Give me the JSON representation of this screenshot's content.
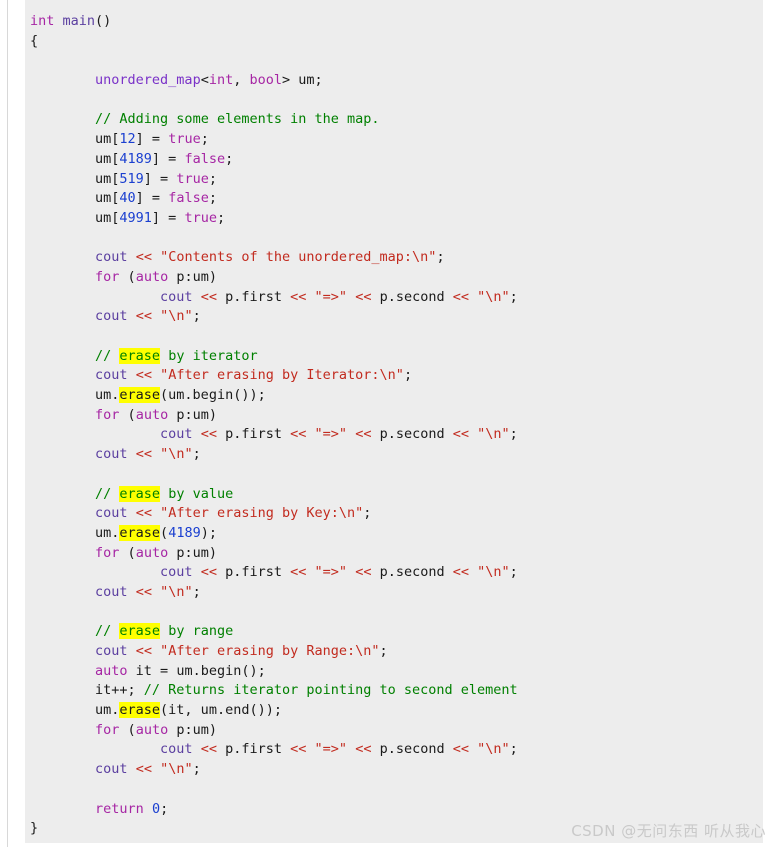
{
  "watermark": {
    "text": "CSDN @无问东西 听从我心"
  },
  "colors": {
    "page_background": "#ffffff",
    "code_background": "#ededed",
    "keyword": "#a626a4",
    "type": "#7a32c8",
    "identifier": "#5b3fa0",
    "number": "#1a3fd0",
    "string": "#c22b1f",
    "comment": "#008000",
    "plain": "#1a1a1a",
    "highlight": "#ffff00",
    "rule": "#d8d8d8",
    "watermark": "#c9c9c9"
  },
  "code": {
    "language": "cpp",
    "highlight_term": "erase",
    "lines": [
      {
        "n": 1,
        "tokens": [
          {
            "t": "int",
            "c": "kw"
          },
          {
            "t": " ",
            "c": "plain"
          },
          {
            "t": "main",
            "c": "ident"
          },
          {
            "t": "()",
            "c": "plain"
          }
        ]
      },
      {
        "n": 2,
        "tokens": [
          {
            "t": "{",
            "c": "plain"
          }
        ]
      },
      {
        "n": 3,
        "tokens": []
      },
      {
        "n": 4,
        "tokens": [
          {
            "t": "        ",
            "c": "plain"
          },
          {
            "t": "unordered_map",
            "c": "type"
          },
          {
            "t": "<",
            "c": "plain"
          },
          {
            "t": "int",
            "c": "kw"
          },
          {
            "t": ", ",
            "c": "plain"
          },
          {
            "t": "bool",
            "c": "kw"
          },
          {
            "t": "> um;",
            "c": "plain"
          }
        ]
      },
      {
        "n": 5,
        "tokens": []
      },
      {
        "n": 6,
        "tokens": [
          {
            "t": "        ",
            "c": "plain"
          },
          {
            "t": "// Adding some elements in the map.",
            "c": "cmt"
          }
        ]
      },
      {
        "n": 7,
        "tokens": [
          {
            "t": "        um[",
            "c": "plain"
          },
          {
            "t": "12",
            "c": "num"
          },
          {
            "t": "] = ",
            "c": "plain"
          },
          {
            "t": "true",
            "c": "kw"
          },
          {
            "t": ";",
            "c": "plain"
          }
        ]
      },
      {
        "n": 8,
        "tokens": [
          {
            "t": "        um[",
            "c": "plain"
          },
          {
            "t": "4189",
            "c": "num"
          },
          {
            "t": "] = ",
            "c": "plain"
          },
          {
            "t": "false",
            "c": "kw"
          },
          {
            "t": ";",
            "c": "plain"
          }
        ]
      },
      {
        "n": 9,
        "tokens": [
          {
            "t": "        um[",
            "c": "plain"
          },
          {
            "t": "519",
            "c": "num"
          },
          {
            "t": "] = ",
            "c": "plain"
          },
          {
            "t": "true",
            "c": "kw"
          },
          {
            "t": ";",
            "c": "plain"
          }
        ]
      },
      {
        "n": 10,
        "tokens": [
          {
            "t": "        um[",
            "c": "plain"
          },
          {
            "t": "40",
            "c": "num"
          },
          {
            "t": "] = ",
            "c": "plain"
          },
          {
            "t": "false",
            "c": "kw"
          },
          {
            "t": ";",
            "c": "plain"
          }
        ]
      },
      {
        "n": 11,
        "tokens": [
          {
            "t": "        um[",
            "c": "plain"
          },
          {
            "t": "4991",
            "c": "num"
          },
          {
            "t": "] = ",
            "c": "plain"
          },
          {
            "t": "true",
            "c": "kw"
          },
          {
            "t": ";",
            "c": "plain"
          }
        ]
      },
      {
        "n": 12,
        "tokens": []
      },
      {
        "n": 13,
        "tokens": [
          {
            "t": "        ",
            "c": "plain"
          },
          {
            "t": "cout",
            "c": "ident"
          },
          {
            "t": " ",
            "c": "plain"
          },
          {
            "t": "<<",
            "c": "op"
          },
          {
            "t": " ",
            "c": "plain"
          },
          {
            "t": "\"Contents of the unordered_map:\\n\"",
            "c": "str"
          },
          {
            "t": ";",
            "c": "plain"
          }
        ]
      },
      {
        "n": 14,
        "tokens": [
          {
            "t": "        ",
            "c": "plain"
          },
          {
            "t": "for",
            "c": "kw"
          },
          {
            "t": " (",
            "c": "plain"
          },
          {
            "t": "auto",
            "c": "kw"
          },
          {
            "t": " p:um)",
            "c": "plain"
          }
        ]
      },
      {
        "n": 15,
        "tokens": [
          {
            "t": "                ",
            "c": "plain"
          },
          {
            "t": "cout",
            "c": "ident"
          },
          {
            "t": " ",
            "c": "plain"
          },
          {
            "t": "<<",
            "c": "op"
          },
          {
            "t": " p.first ",
            "c": "plain"
          },
          {
            "t": "<<",
            "c": "op"
          },
          {
            "t": " ",
            "c": "plain"
          },
          {
            "t": "\"=>\"",
            "c": "str"
          },
          {
            "t": " ",
            "c": "plain"
          },
          {
            "t": "<<",
            "c": "op"
          },
          {
            "t": " p.second ",
            "c": "plain"
          },
          {
            "t": "<<",
            "c": "op"
          },
          {
            "t": " ",
            "c": "plain"
          },
          {
            "t": "\"\\n\"",
            "c": "str"
          },
          {
            "t": ";",
            "c": "plain"
          }
        ]
      },
      {
        "n": 16,
        "tokens": [
          {
            "t": "        ",
            "c": "plain"
          },
          {
            "t": "cout",
            "c": "ident"
          },
          {
            "t": " ",
            "c": "plain"
          },
          {
            "t": "<<",
            "c": "op"
          },
          {
            "t": " ",
            "c": "plain"
          },
          {
            "t": "\"\\n\"",
            "c": "str"
          },
          {
            "t": ";",
            "c": "plain"
          }
        ]
      },
      {
        "n": 17,
        "tokens": []
      },
      {
        "n": 18,
        "tokens": [
          {
            "t": "        ",
            "c": "plain"
          },
          {
            "t": "// ",
            "c": "cmt"
          },
          {
            "t": "erase",
            "c": "hl-cmt"
          },
          {
            "t": " by iterator",
            "c": "cmt"
          }
        ]
      },
      {
        "n": 19,
        "tokens": [
          {
            "t": "        ",
            "c": "plain"
          },
          {
            "t": "cout",
            "c": "ident"
          },
          {
            "t": " ",
            "c": "plain"
          },
          {
            "t": "<<",
            "c": "op"
          },
          {
            "t": " ",
            "c": "plain"
          },
          {
            "t": "\"After erasing by Iterator:\\n\"",
            "c": "str"
          },
          {
            "t": ";",
            "c": "plain"
          }
        ]
      },
      {
        "n": 20,
        "tokens": [
          {
            "t": "        um.",
            "c": "plain"
          },
          {
            "t": "erase",
            "c": "hl-code"
          },
          {
            "t": "(um.begin());",
            "c": "plain"
          }
        ]
      },
      {
        "n": 21,
        "tokens": [
          {
            "t": "        ",
            "c": "plain"
          },
          {
            "t": "for",
            "c": "kw"
          },
          {
            "t": " (",
            "c": "plain"
          },
          {
            "t": "auto",
            "c": "kw"
          },
          {
            "t": " p:um)",
            "c": "plain"
          }
        ]
      },
      {
        "n": 22,
        "tokens": [
          {
            "t": "                ",
            "c": "plain"
          },
          {
            "t": "cout",
            "c": "ident"
          },
          {
            "t": " ",
            "c": "plain"
          },
          {
            "t": "<<",
            "c": "op"
          },
          {
            "t": " p.first ",
            "c": "plain"
          },
          {
            "t": "<<",
            "c": "op"
          },
          {
            "t": " ",
            "c": "plain"
          },
          {
            "t": "\"=>\"",
            "c": "str"
          },
          {
            "t": " ",
            "c": "plain"
          },
          {
            "t": "<<",
            "c": "op"
          },
          {
            "t": " p.second ",
            "c": "plain"
          },
          {
            "t": "<<",
            "c": "op"
          },
          {
            "t": " ",
            "c": "plain"
          },
          {
            "t": "\"\\n\"",
            "c": "str"
          },
          {
            "t": ";",
            "c": "plain"
          }
        ]
      },
      {
        "n": 23,
        "tokens": [
          {
            "t": "        ",
            "c": "plain"
          },
          {
            "t": "cout",
            "c": "ident"
          },
          {
            "t": " ",
            "c": "plain"
          },
          {
            "t": "<<",
            "c": "op"
          },
          {
            "t": " ",
            "c": "plain"
          },
          {
            "t": "\"\\n\"",
            "c": "str"
          },
          {
            "t": ";",
            "c": "plain"
          }
        ]
      },
      {
        "n": 24,
        "tokens": []
      },
      {
        "n": 25,
        "tokens": [
          {
            "t": "        ",
            "c": "plain"
          },
          {
            "t": "// ",
            "c": "cmt"
          },
          {
            "t": "erase",
            "c": "hl-cmt"
          },
          {
            "t": " by value",
            "c": "cmt"
          }
        ]
      },
      {
        "n": 26,
        "tokens": [
          {
            "t": "        ",
            "c": "plain"
          },
          {
            "t": "cout",
            "c": "ident"
          },
          {
            "t": " ",
            "c": "plain"
          },
          {
            "t": "<<",
            "c": "op"
          },
          {
            "t": " ",
            "c": "plain"
          },
          {
            "t": "\"After erasing by Key:\\n\"",
            "c": "str"
          },
          {
            "t": ";",
            "c": "plain"
          }
        ]
      },
      {
        "n": 27,
        "tokens": [
          {
            "t": "        um.",
            "c": "plain"
          },
          {
            "t": "erase",
            "c": "hl-code"
          },
          {
            "t": "(",
            "c": "plain"
          },
          {
            "t": "4189",
            "c": "num"
          },
          {
            "t": ");",
            "c": "plain"
          }
        ]
      },
      {
        "n": 28,
        "tokens": [
          {
            "t": "        ",
            "c": "plain"
          },
          {
            "t": "for",
            "c": "kw"
          },
          {
            "t": " (",
            "c": "plain"
          },
          {
            "t": "auto",
            "c": "kw"
          },
          {
            "t": " p:um)",
            "c": "plain"
          }
        ]
      },
      {
        "n": 29,
        "tokens": [
          {
            "t": "                ",
            "c": "plain"
          },
          {
            "t": "cout",
            "c": "ident"
          },
          {
            "t": " ",
            "c": "plain"
          },
          {
            "t": "<<",
            "c": "op"
          },
          {
            "t": " p.first ",
            "c": "plain"
          },
          {
            "t": "<<",
            "c": "op"
          },
          {
            "t": " ",
            "c": "plain"
          },
          {
            "t": "\"=>\"",
            "c": "str"
          },
          {
            "t": " ",
            "c": "plain"
          },
          {
            "t": "<<",
            "c": "op"
          },
          {
            "t": " p.second ",
            "c": "plain"
          },
          {
            "t": "<<",
            "c": "op"
          },
          {
            "t": " ",
            "c": "plain"
          },
          {
            "t": "\"\\n\"",
            "c": "str"
          },
          {
            "t": ";",
            "c": "plain"
          }
        ]
      },
      {
        "n": 30,
        "tokens": [
          {
            "t": "        ",
            "c": "plain"
          },
          {
            "t": "cout",
            "c": "ident"
          },
          {
            "t": " ",
            "c": "plain"
          },
          {
            "t": "<<",
            "c": "op"
          },
          {
            "t": " ",
            "c": "plain"
          },
          {
            "t": "\"\\n\"",
            "c": "str"
          },
          {
            "t": ";",
            "c": "plain"
          }
        ]
      },
      {
        "n": 31,
        "tokens": []
      },
      {
        "n": 32,
        "tokens": [
          {
            "t": "        ",
            "c": "plain"
          },
          {
            "t": "// ",
            "c": "cmt"
          },
          {
            "t": "erase",
            "c": "hl-cmt"
          },
          {
            "t": " by range",
            "c": "cmt"
          }
        ]
      },
      {
        "n": 33,
        "tokens": [
          {
            "t": "        ",
            "c": "plain"
          },
          {
            "t": "cout",
            "c": "ident"
          },
          {
            "t": " ",
            "c": "plain"
          },
          {
            "t": "<<",
            "c": "op"
          },
          {
            "t": " ",
            "c": "plain"
          },
          {
            "t": "\"After erasing by Range:\\n\"",
            "c": "str"
          },
          {
            "t": ";",
            "c": "plain"
          }
        ]
      },
      {
        "n": 34,
        "tokens": [
          {
            "t": "        ",
            "c": "plain"
          },
          {
            "t": "auto",
            "c": "kw"
          },
          {
            "t": " it = um.begin();",
            "c": "plain"
          }
        ]
      },
      {
        "n": 35,
        "tokens": [
          {
            "t": "        it++; ",
            "c": "plain"
          },
          {
            "t": "// Returns iterator pointing to second element",
            "c": "cmt"
          }
        ]
      },
      {
        "n": 36,
        "tokens": [
          {
            "t": "        um.",
            "c": "plain"
          },
          {
            "t": "erase",
            "c": "hl-code"
          },
          {
            "t": "(it, um.end());",
            "c": "plain"
          }
        ]
      },
      {
        "n": 37,
        "tokens": [
          {
            "t": "        ",
            "c": "plain"
          },
          {
            "t": "for",
            "c": "kw"
          },
          {
            "t": " (",
            "c": "plain"
          },
          {
            "t": "auto",
            "c": "kw"
          },
          {
            "t": " p:um)",
            "c": "plain"
          }
        ]
      },
      {
        "n": 38,
        "tokens": [
          {
            "t": "                ",
            "c": "plain"
          },
          {
            "t": "cout",
            "c": "ident"
          },
          {
            "t": " ",
            "c": "plain"
          },
          {
            "t": "<<",
            "c": "op"
          },
          {
            "t": " p.first ",
            "c": "plain"
          },
          {
            "t": "<<",
            "c": "op"
          },
          {
            "t": " ",
            "c": "plain"
          },
          {
            "t": "\"=>\"",
            "c": "str"
          },
          {
            "t": " ",
            "c": "plain"
          },
          {
            "t": "<<",
            "c": "op"
          },
          {
            "t": " p.second ",
            "c": "plain"
          },
          {
            "t": "<<",
            "c": "op"
          },
          {
            "t": " ",
            "c": "plain"
          },
          {
            "t": "\"\\n\"",
            "c": "str"
          },
          {
            "t": ";",
            "c": "plain"
          }
        ]
      },
      {
        "n": 39,
        "tokens": [
          {
            "t": "        ",
            "c": "plain"
          },
          {
            "t": "cout",
            "c": "ident"
          },
          {
            "t": " ",
            "c": "plain"
          },
          {
            "t": "<<",
            "c": "op"
          },
          {
            "t": " ",
            "c": "plain"
          },
          {
            "t": "\"\\n\"",
            "c": "str"
          },
          {
            "t": ";",
            "c": "plain"
          }
        ]
      },
      {
        "n": 40,
        "tokens": []
      },
      {
        "n": 41,
        "tokens": [
          {
            "t": "        ",
            "c": "plain"
          },
          {
            "t": "return",
            "c": "kw"
          },
          {
            "t": " ",
            "c": "plain"
          },
          {
            "t": "0",
            "c": "num"
          },
          {
            "t": ";",
            "c": "plain"
          }
        ]
      },
      {
        "n": 42,
        "tokens": [
          {
            "t": "}",
            "c": "plain"
          }
        ]
      }
    ]
  }
}
